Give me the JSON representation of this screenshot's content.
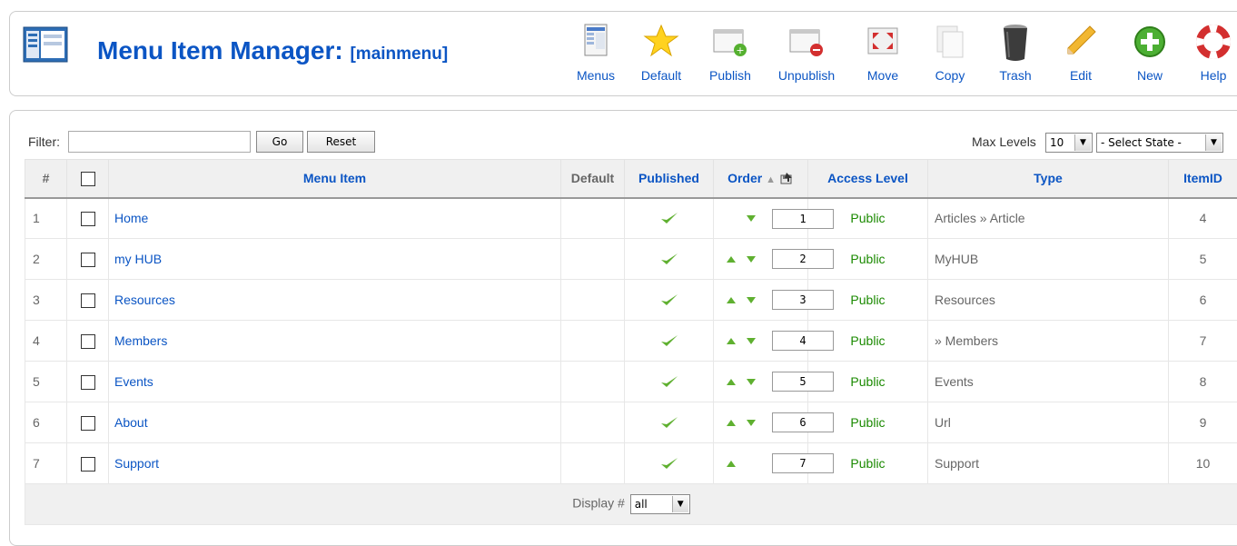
{
  "header": {
    "title": "Menu Item Manager:",
    "subtitle": "[mainmenu]"
  },
  "toolbar": [
    {
      "label": "Menus",
      "icon": "menus-icon"
    },
    {
      "label": "Default",
      "icon": "star-icon"
    },
    {
      "label": "Publish",
      "icon": "publish-icon"
    },
    {
      "label": "Unpublish",
      "icon": "unpublish-icon"
    },
    {
      "label": "Move",
      "icon": "move-icon"
    },
    {
      "label": "Copy",
      "icon": "copy-icon"
    },
    {
      "label": "Trash",
      "icon": "trash-icon"
    },
    {
      "label": "Edit",
      "icon": "pencil-icon"
    },
    {
      "label": "New",
      "icon": "plus-icon"
    },
    {
      "label": "Help",
      "icon": "lifebuoy-icon"
    }
  ],
  "filter": {
    "label": "Filter:",
    "value": "",
    "go_label": "Go",
    "reset_label": "Reset",
    "max_levels_label": "Max Levels",
    "max_levels_value": "10",
    "state_value": "- Select State -"
  },
  "table": {
    "headers": {
      "num": "#",
      "menu_item": "Menu Item",
      "default": "Default",
      "published": "Published",
      "order": "Order",
      "access": "Access Level",
      "type": "Type",
      "itemid": "ItemID"
    },
    "rows": [
      {
        "num": "1",
        "name": "Home",
        "order": "1",
        "access": "Public",
        "type": "Articles » Article",
        "itemid": "4"
      },
      {
        "num": "2",
        "name": "my HUB",
        "order": "2",
        "access": "Public",
        "type": "MyHUB",
        "itemid": "5"
      },
      {
        "num": "3",
        "name": "Resources",
        "order": "3",
        "access": "Public",
        "type": "Resources",
        "itemid": "6"
      },
      {
        "num": "4",
        "name": "Members",
        "order": "4",
        "access": "Public",
        "type": "» Members",
        "itemid": "7"
      },
      {
        "num": "5",
        "name": "Events",
        "order": "5",
        "access": "Public",
        "type": "Events",
        "itemid": "8"
      },
      {
        "num": "6",
        "name": "About",
        "order": "6",
        "access": "Public",
        "type": "Url",
        "itemid": "9"
      },
      {
        "num": "7",
        "name": "Support",
        "order": "7",
        "access": "Public",
        "type": "Support",
        "itemid": "10"
      }
    ],
    "footer": {
      "display_label": "Display #",
      "display_value": "all"
    }
  },
  "colors": {
    "link": "#0b55c4",
    "access": "#1a8a00",
    "check": "#5fb030"
  }
}
